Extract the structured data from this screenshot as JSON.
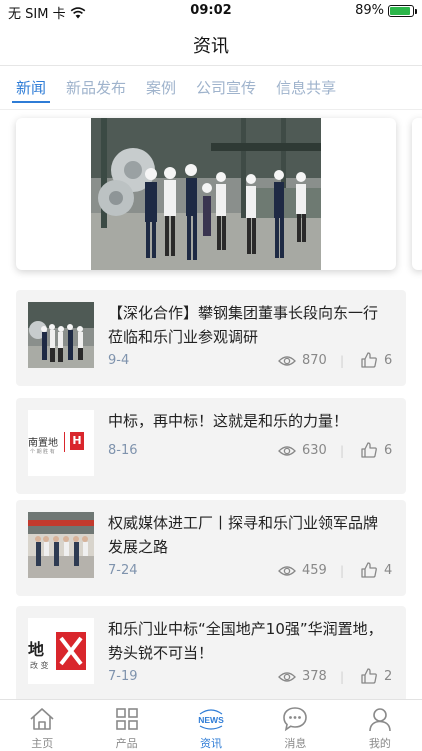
{
  "status_bar": {
    "carrier": "无 SIM 卡",
    "time": "09:02",
    "battery": "89%",
    "battery_level": 0.89
  },
  "nav": {
    "title": "资讯"
  },
  "tabs": [
    {
      "label": "新闻",
      "active": true
    },
    {
      "label": "新品发布",
      "active": false
    },
    {
      "label": "案例",
      "active": false
    },
    {
      "label": "公司宣传",
      "active": false
    },
    {
      "label": "信息共享",
      "active": false
    }
  ],
  "news": [
    {
      "title": "【深化合作】攀钢集团董事长段向东一行莅临和乐门业参观调研",
      "date": "9-4",
      "views": "870",
      "likes": "6"
    },
    {
      "title": "中标，再中标！这就是和乐的力量！",
      "date": "8-16",
      "views": "630",
      "likes": "6"
    },
    {
      "title": "权威媒体进工厂丨探寻和乐门业领军品牌发展之路",
      "date": "7-24",
      "views": "459",
      "likes": "4"
    },
    {
      "title": "和乐门业中标“全国地产10强”华润置地，势头锐不可当！",
      "date": "7-19",
      "views": "378",
      "likes": "2"
    }
  ],
  "thumb_text": {
    "logo2_left": "南置地",
    "logo2_sub": "个 期 胜 有",
    "logo2_right": "H",
    "logo4_left": "地",
    "logo4_sub": "改 变"
  },
  "tabbar": [
    {
      "label": "主页",
      "icon": "home-icon",
      "active": false
    },
    {
      "label": "产品",
      "icon": "grid-icon",
      "active": false
    },
    {
      "label": "资讯",
      "icon": "news-icon",
      "icon_text": "NEWS",
      "active": true
    },
    {
      "label": "消息",
      "icon": "chat-bubble-icon",
      "active": false
    },
    {
      "label": "我的",
      "icon": "user-icon",
      "active": false
    }
  ],
  "colors": {
    "accent": "#2e7cd6",
    "tab_inactive": "#9fb3cc",
    "card_bg": "#f3f3f3",
    "logo_red": "#d9262c"
  }
}
